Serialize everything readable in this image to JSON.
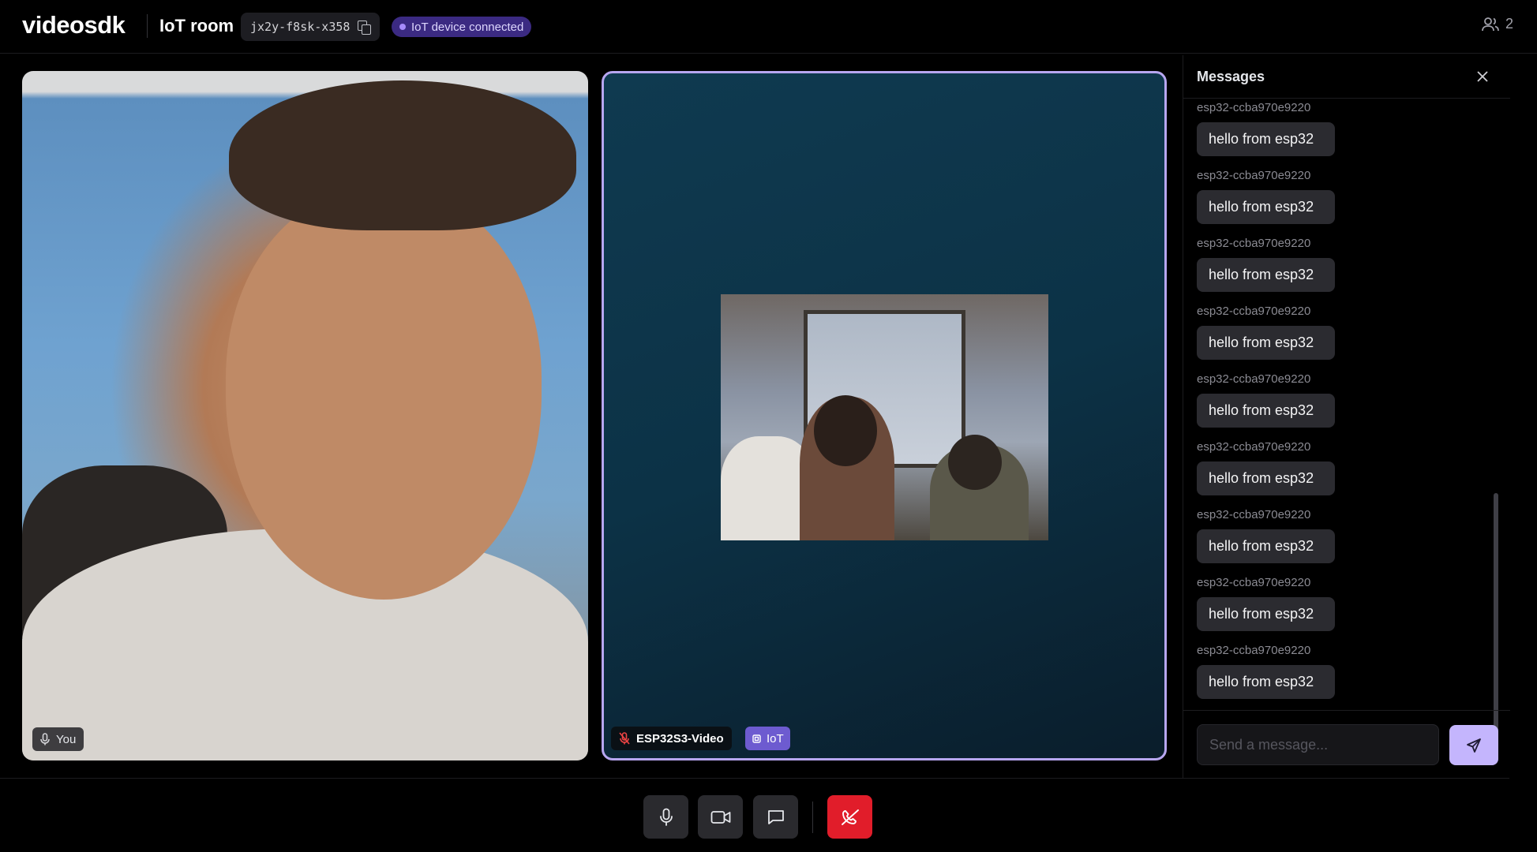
{
  "header": {
    "logo": "videosdk",
    "room_title": "IoT room",
    "meeting_id": "jx2y-f8sk-x358",
    "iot_status": "IoT device connected",
    "participant_count": "2"
  },
  "tiles": {
    "local": {
      "label": "You",
      "mic_icon": "mic-icon"
    },
    "remote": {
      "label": "ESP32S3-Video",
      "mic_icon": "mic-off-icon",
      "chip": "IoT",
      "border_color": "#b7a6f0"
    }
  },
  "chat": {
    "title": "Messages",
    "messages": [
      {
        "sender": "esp32-ccba970e9220",
        "text": "hello from esp32"
      },
      {
        "sender": "esp32-ccba970e9220",
        "text": "hello from esp32"
      },
      {
        "sender": "esp32-ccba970e9220",
        "text": "hello from esp32"
      },
      {
        "sender": "esp32-ccba970e9220",
        "text": "hello from esp32"
      },
      {
        "sender": "esp32-ccba970e9220",
        "text": "hello from esp32"
      },
      {
        "sender": "esp32-ccba970e9220",
        "text": "hello from esp32"
      },
      {
        "sender": "esp32-ccba970e9220",
        "text": "hello from esp32"
      },
      {
        "sender": "esp32-ccba970e9220",
        "text": "hello from esp32"
      },
      {
        "sender": "esp32-ccba970e9220",
        "text": "hello from esp32"
      }
    ],
    "input_placeholder": "Send a message...",
    "input_value": ""
  },
  "controls": [
    "mic-icon",
    "camera-icon",
    "chat-icon",
    "end-call-icon"
  ],
  "colors": {
    "accent": "#c4b5fd",
    "badge_bg": "#3b2a82",
    "end_call": "#e11d2a",
    "background": "#000000"
  }
}
